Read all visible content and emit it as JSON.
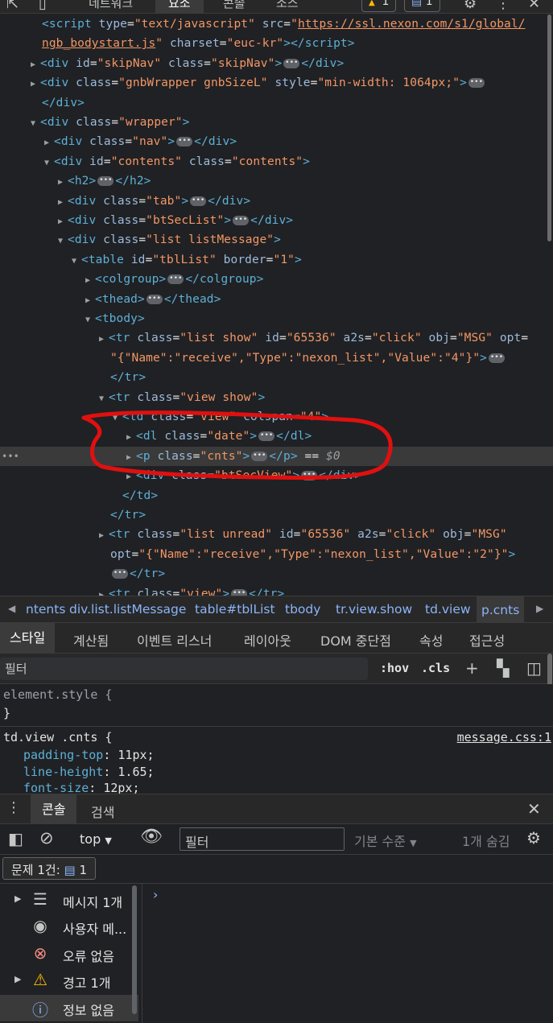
{
  "top_tabs": {
    "network": "네트워크",
    "elements": "요소",
    "console": "콘솔",
    "sources": "소스",
    "warning_count": "1",
    "message_count": "1"
  },
  "tree_lines": [
    {
      "html": "<span class='tag'>&lt;script</span> <span class='attr'>type</span>=<span class='val'>\"text/javascript\"</span> <span class='attr'>src</span>=<span class='val'>\"</span><span class='link'>https://ssl.nexon.com/s1/global/</span>"
    },
    {
      "html": "<span class='link'>ngb_bodystart.js</span><span class='val'>\"</span> <span class='attr'>charset</span>=<span class='val'>\"euc-kr\"</span><span class='tag'>&gt;&lt;/script&gt;</span>"
    }
  ],
  "tree": {
    "l01": "<script",
    "skipnav": "<div id=\"skipNav\" class=\"skipNav\">",
    "gnb": "<div class=\"gnbWrapper gnbSizeL\" style=\"min-width: 1064px;\">",
    "gnb_close": "</div>",
    "wrapper": "<div class=\"wrapper\">",
    "nav": "<div class=\"nav\">",
    "contents": "<div id=\"contents\" class=\"contents\">",
    "h2": "<h2>",
    "tab": "<div class=\"tab\">",
    "btseclist": "<div class=\"btSecList\">",
    "listmessage": "<div class=\"list listMessage\">",
    "table": "<table id=\"tblList\" border=\"1\">",
    "colgroup": "<colgroup>",
    "thead": "<thead>",
    "tbody": "<tbody>",
    "tr1a": "<tr class=\"list show\" id=\"65536\" a2s=\"click\" obj=\"MSG\" opt=",
    "tr1b": "\"{\"Name\":\"receive\",\"Type\":\"nexon_list\",\"Value\":\"4\"}\">",
    "tr_close": "</tr>",
    "tr2": "<tr class=\"view show\">",
    "td": "<td class=\"view\" colspan=\"4\">",
    "dl": "<dl class=\"date\">",
    "p": "<p class=\"cnts\">",
    "p_suffix": "== $0",
    "btsecview": "<div class=\"btSecView\">",
    "td_close": "</td>",
    "tr3a": "<tr class=\"list unread\" id=\"65536\" a2s=\"click\" obj=\"MSG\"",
    "tr3b": "opt=\"{\"Name\":\"receive\",\"Type\":\"nexon_list\",\"Value\":\"2\"}\">",
    "tr4": "<tr class=\"view\">"
  },
  "breadcrumbs": [
    "ntents",
    "div.list.listMessage",
    "table#tblList",
    "tbody",
    "tr.view.show",
    "td.view",
    "p.cnts"
  ],
  "styles_tabs": [
    "스타일",
    "계산됨",
    "이벤트 리스너",
    "레이아웃",
    "DOM 중단점",
    "속성",
    "접근성"
  ],
  "styles_filter": {
    "placeholder": "필터",
    "hov": ":hov",
    "cls": ".cls"
  },
  "styles": {
    "element_style": "element.style {",
    "element_close": "}",
    "rule_selector": "td.view .cnts {",
    "rule_source": "message.css:1",
    "props": [
      {
        "name": "padding-top",
        "value": "11px;"
      },
      {
        "name": "line-height",
        "value": "1.65;"
      },
      {
        "name": "font-size",
        "value": "12px;"
      }
    ]
  },
  "drawer": {
    "tabs": [
      "콘솔",
      "검색"
    ],
    "context": "top",
    "filter_placeholder": "필터",
    "levels": "기본 수준",
    "hidden": "1개 숨김",
    "issues_label": "문제 1건:",
    "issues_count": "1",
    "prompt": "›"
  },
  "sidebar": [
    {
      "label": "메시지 1개",
      "icon": "list-icon",
      "expandable": true
    },
    {
      "label": "사용자 메...",
      "icon": "user-icon",
      "expandable": false
    },
    {
      "label": "오류 없음",
      "icon": "error-icon",
      "expandable": false
    },
    {
      "label": "경고 1개",
      "icon": "warning-icon",
      "expandable": true
    },
    {
      "label": "정보 없음",
      "icon": "info-icon",
      "expandable": false
    }
  ],
  "colors": {
    "tag": "#5db0d7",
    "attr": "#9bbbdc",
    "value": "#f29766",
    "annotation": "#e01010",
    "link": "#8ab4f8"
  }
}
